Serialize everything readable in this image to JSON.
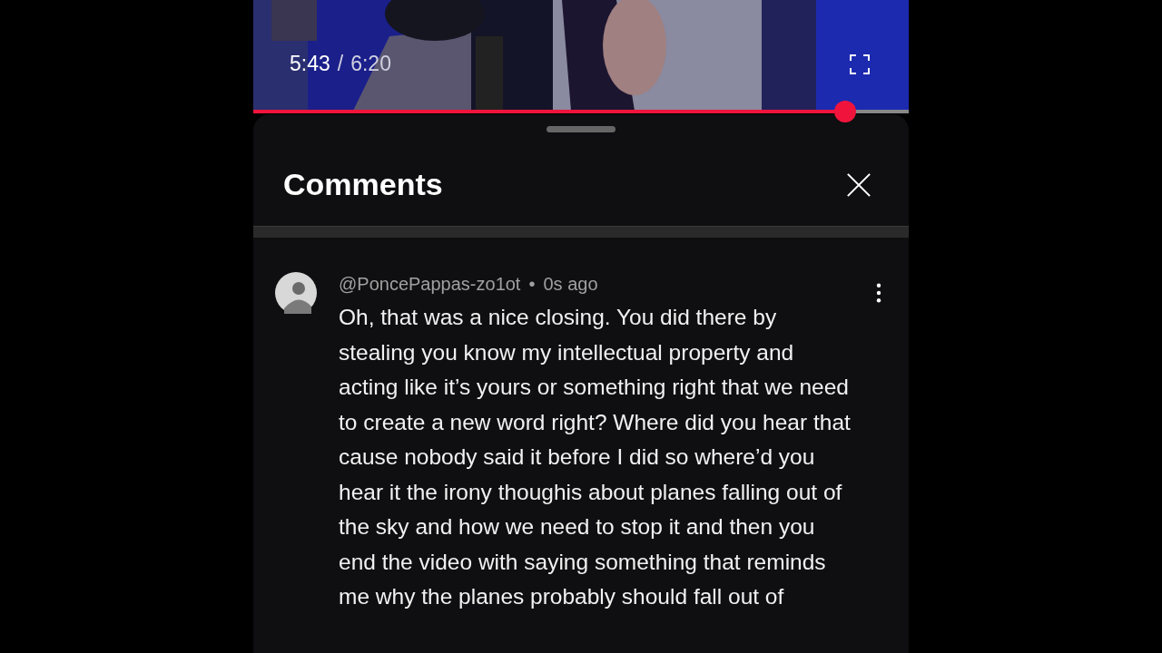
{
  "player": {
    "current_time": "5:43",
    "separator": "/",
    "duration": "6:20",
    "progress": {
      "level": 0.903
    }
  },
  "comments_panel": {
    "title": "Comments",
    "comments": [
      {
        "author": "@PoncePappas-zo1ot",
        "dot": "•",
        "time": "0s ago",
        "text": "Oh, that was a nice closing. You did there by stealing you know my intellectual property and acting like it’s yours or something right that we need to create a new word right? Where did you hear that cause nobody said it before I did so where’d you hear it the irony thoughis about planes falling out of the sky and how we need to stop it and then you end the video with saying something that reminds me why the planes probably should fall out of"
      }
    ]
  }
}
